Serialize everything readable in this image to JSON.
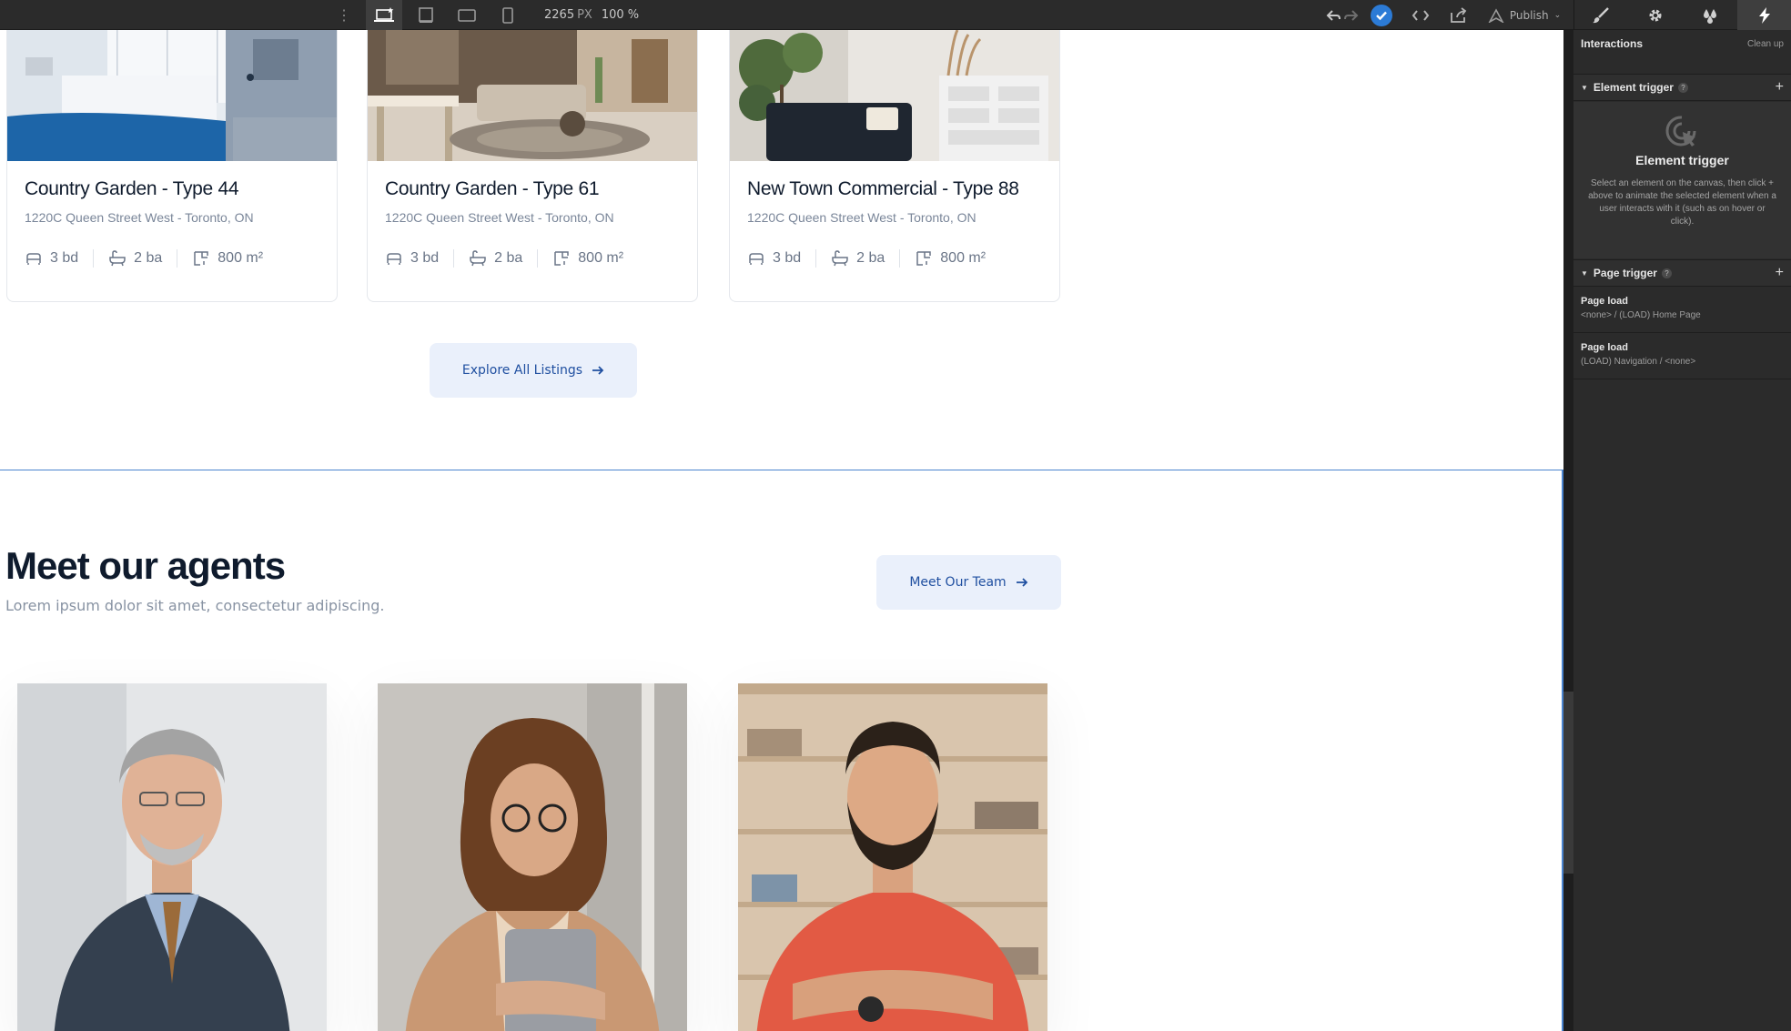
{
  "toolbar": {
    "width_value": "2265",
    "width_unit": "PX",
    "zoom": "100 %",
    "publish_label": "Publish"
  },
  "listings": [
    {
      "title": "Country Garden - Type 44",
      "address": "1220C Queen Street West - Toronto, ON",
      "beds": "3 bd",
      "baths": "2 ba",
      "area": "800 m²"
    },
    {
      "title": "Country Garden - Type 61",
      "address": "1220C Queen Street West - Toronto, ON",
      "beds": "3 bd",
      "baths": "2 ba",
      "area": "800 m²"
    },
    {
      "title": "New Town Commercial - Type 88",
      "address": "1220C Queen Street West - Toronto, ON",
      "beds": "3 bd",
      "baths": "2 ba",
      "area": "800 m²"
    }
  ],
  "explore_button": "Explore All Listings",
  "agents_section": {
    "title": "Meet our agents",
    "subtitle": "Lorem ipsum dolor sit amet, consectetur adipiscing.",
    "team_button": "Meet Our Team"
  },
  "panel": {
    "title": "Interactions",
    "cleanup": "Clean up",
    "element_trigger_header": "Element trigger",
    "element_trigger_title": "Element trigger",
    "element_trigger_desc": "Select an element on the canvas, then click + above to animate the selected element when a user interacts with it (such as on hover or click).",
    "page_trigger_header": "Page trigger",
    "page_triggers": [
      {
        "title": "Page load",
        "detail": "<none> / (LOAD) Home Page"
      },
      {
        "title": "Page load",
        "detail": "(LOAD) Navigation / <none>"
      }
    ]
  },
  "colors": {
    "toolbar_bg": "#2b2b2b",
    "accent_blue": "#2c7bd6",
    "button_soft_bg": "#eaf0fb",
    "button_soft_text": "#1f4fa0",
    "heading": "#0f1b2d"
  }
}
